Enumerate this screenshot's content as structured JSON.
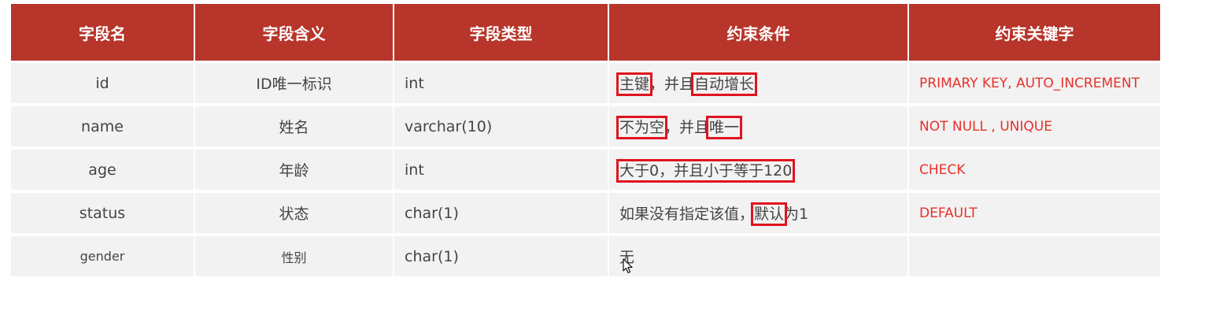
{
  "table": {
    "headers": [
      "字段名",
      "字段含义",
      "字段类型",
      "约束条件",
      "约束关键字"
    ],
    "rows": [
      {
        "name": "id",
        "meaning": "ID唯一标识",
        "type": "int",
        "constraint": {
          "p1": "主键",
          "p2": "，并且",
          "p3": "自动增长",
          "p4": ""
        },
        "keyword": "PRIMARY KEY, AUTO_INCREMENT"
      },
      {
        "name": "name",
        "meaning": "姓名",
        "type": "varchar(10)",
        "constraint": {
          "p1": "不为空",
          "p2": "，并且",
          "p3": "唯一",
          "p4": ""
        },
        "keyword": "NOT  NULL , UNIQUE"
      },
      {
        "name": "age",
        "meaning": "年龄",
        "type": "int",
        "constraint": {
          "p1": "大于0，并且小于等于120"
        },
        "keyword": "CHECK"
      },
      {
        "name": "status",
        "meaning": "状态",
        "type": "char(1)",
        "constraint": {
          "p1": "如果没有指定该值，",
          "p2": "默认",
          "p3": "为1"
        },
        "keyword": "DEFAULT"
      },
      {
        "name": "gender",
        "meaning": "性别",
        "type": "char(1)",
        "constraint": {
          "p1": "无"
        },
        "keyword": ""
      }
    ]
  },
  "colors": {
    "header_bg": "#b7352a",
    "row_bg": "#f2f2f2",
    "keyword_text": "#e8302a",
    "highlight_box": "#e0141e"
  },
  "icons": [
    "mouse-cursor-icon"
  ]
}
